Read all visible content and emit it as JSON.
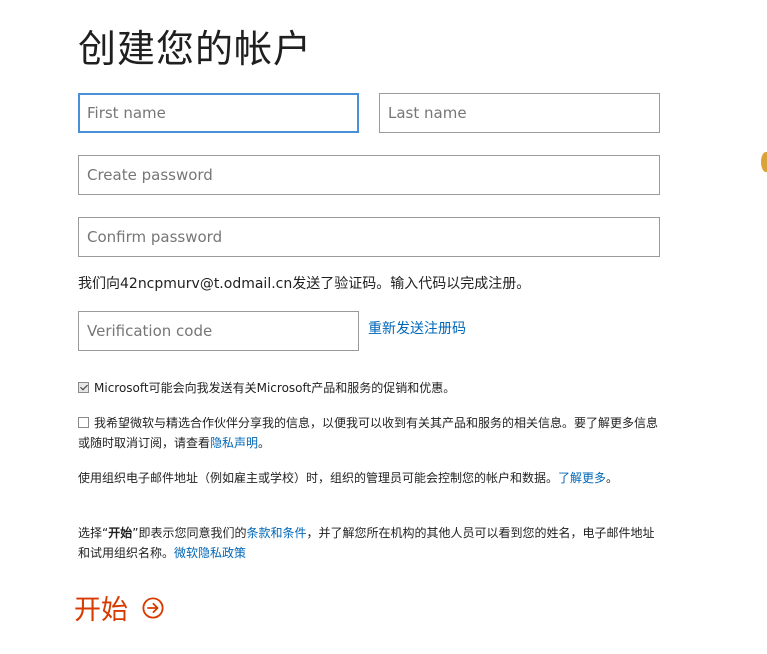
{
  "page": {
    "title": "创建您的帐户"
  },
  "form": {
    "first_name": {
      "placeholder": "First name",
      "value": ""
    },
    "last_name": {
      "placeholder": "Last name",
      "value": ""
    },
    "password": {
      "placeholder": "Create password",
      "value": ""
    },
    "confirm_password": {
      "placeholder": "Confirm password",
      "value": ""
    },
    "verification_info": "我们向42ncpmurv@t.odmail.cn发送了验证码。输入代码以完成注册。",
    "verification_code": {
      "placeholder": "Verification code",
      "value": ""
    },
    "resend_label": "重新发送注册码"
  },
  "checkboxes": [
    {
      "label": "Microsoft可能会向我发送有关Microsoft产品和服务的促销和优惠。",
      "checked": true
    },
    {
      "label_before": "我希望微软与精选合作伙伴分享我的信息，以便我可以收到有关其产品和服务的相关信息。要了解更多信息或随时取消订阅，请查看",
      "link": "隐私声明",
      "label_after": "。",
      "checked": false
    }
  ],
  "org_notice": {
    "text": "使用组织电子邮件地址（例如雇主或学校）时，组织的管理员可能会控制您的帐户和数据。",
    "link": "了解更多",
    "after": "。"
  },
  "terms": {
    "prefix": "选择“",
    "bold": "开始",
    "mid": "”即表示您同意我们的",
    "terms_link": "条款和条件",
    "rest": "，并了解您所在机构的其他人员可以看到您的姓名，电子邮件地址和试用组织名称。",
    "privacy_link": "微软隐私政策"
  },
  "start_button": {
    "label": "开始",
    "icon": "arrow-circle-right-icon",
    "color": "#d83b01"
  },
  "colors": {
    "link": "#0067b8",
    "focus_border": "#4a90d9",
    "accent": "#d83b01"
  }
}
